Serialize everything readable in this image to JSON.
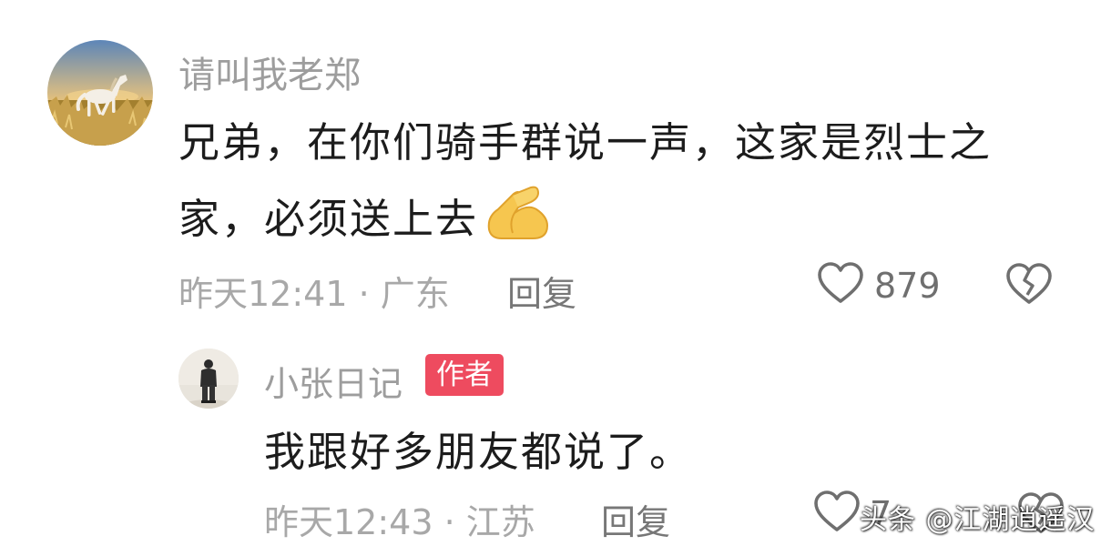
{
  "comment": {
    "username": "请叫我老郑",
    "text_line1": "兄弟，在你们骑手群说一声，这家是烈士之",
    "text_line2": "家，必须送上去",
    "emoji": "pray-hands",
    "time_location": "昨天12:41 · 广东",
    "reply_label": "回复",
    "like_count": "879"
  },
  "reply": {
    "username": "小张日记",
    "badge": "作者",
    "text": "我跟好多朋友都说了。",
    "time_location": "昨天12:43 · 江苏",
    "reply_label": "回复",
    "like_count": "7"
  },
  "watermark": "头条 @江湖逍遥汉",
  "colors": {
    "text_primary": "#1c1c1c",
    "text_secondary": "#9d9d9d",
    "badge_background": "#ee4b5f"
  }
}
